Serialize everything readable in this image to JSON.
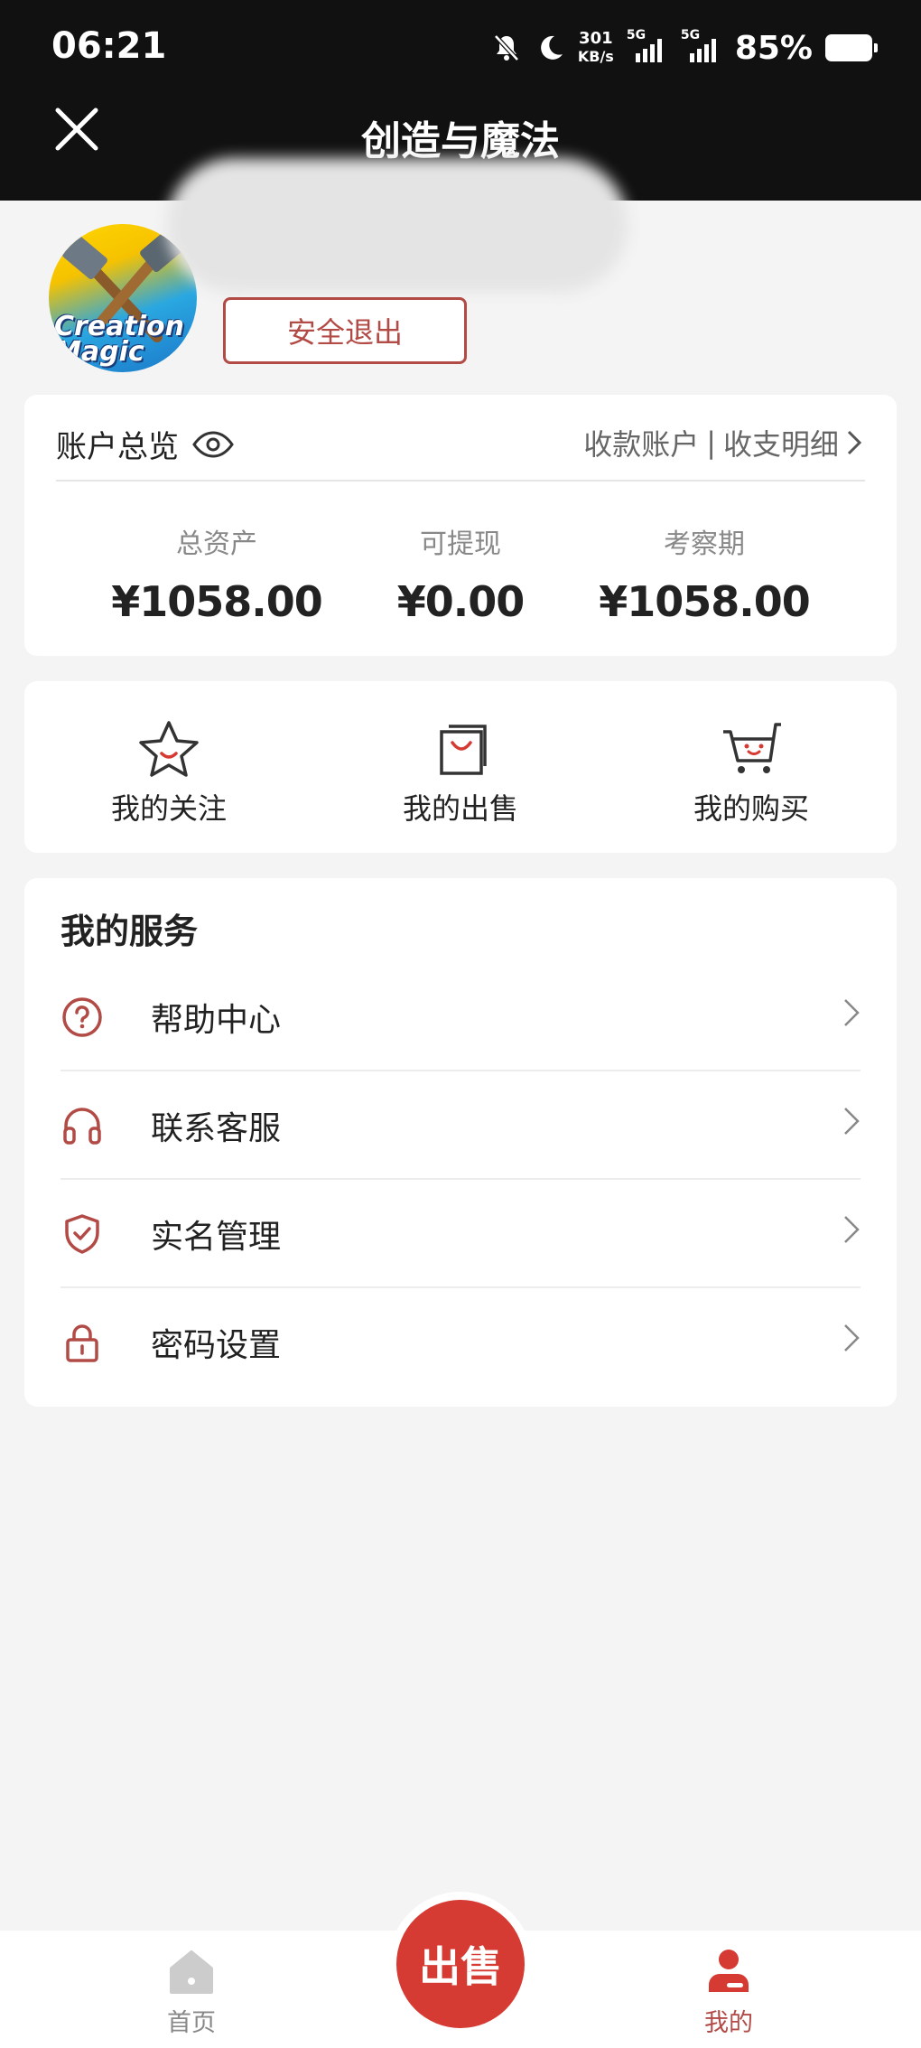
{
  "status_bar": {
    "time": "06:21",
    "speed_value": "301",
    "speed_unit": "KB/s",
    "network_1": "5G",
    "network_2": "5G",
    "battery": "85%"
  },
  "header": {
    "title": "创造与魔法"
  },
  "profile": {
    "avatar_text": "Creation Magic",
    "logout_label": "安全退出"
  },
  "account": {
    "title": "账户总览",
    "link_receive": "收款账户",
    "link_separator": "|",
    "link_detail": "收支明细",
    "stats": [
      {
        "label": "总资产",
        "value": "¥1058.00"
      },
      {
        "label": "可提现",
        "value": "¥0.00"
      },
      {
        "label": "考察期",
        "value": "¥1058.00"
      }
    ]
  },
  "quick_actions": [
    {
      "label": "我的关注",
      "icon": "star-icon"
    },
    {
      "label": "我的出售",
      "icon": "shopping-bag-icon"
    },
    {
      "label": "我的购买",
      "icon": "cart-icon"
    }
  ],
  "services": {
    "title": "我的服务",
    "items": [
      {
        "label": "帮助中心",
        "icon": "question-circle-icon"
      },
      {
        "label": "联系客服",
        "icon": "headset-icon"
      },
      {
        "label": "实名管理",
        "icon": "shield-check-icon"
      },
      {
        "label": "密码设置",
        "icon": "lock-icon"
      }
    ]
  },
  "bottom_nav": {
    "home_label": "首页",
    "sell_label": "出售",
    "mine_label": "我的"
  },
  "colors": {
    "accent": "#b24a45",
    "sell_button": "#d53b33",
    "header_bg": "#111111"
  }
}
